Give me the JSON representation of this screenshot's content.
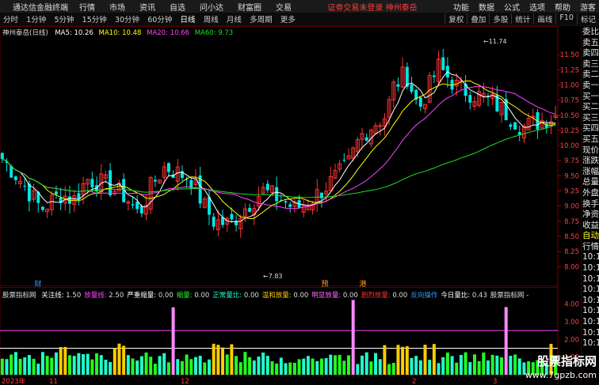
{
  "window": {
    "app_name": "通达信金融终端",
    "menus": [
      "行情",
      "市场",
      "资讯",
      "自选",
      "问小达",
      "财富圈",
      "交易"
    ],
    "notice": "证劵交易未登录",
    "stock_notice": "神州泰岳",
    "right_menu": [
      "功能",
      "数据",
      "公式",
      "选项",
      "帮助",
      "游客"
    ]
  },
  "toolbar": {
    "timeframes": [
      "分时",
      "1分钟",
      "5分钟",
      "15分钟",
      "30分钟",
      "60分钟",
      "日线",
      "周线",
      "月线",
      "多周期",
      "更多"
    ],
    "active_timeframe": "日线",
    "tools": [
      "复权",
      "叠加",
      "多股",
      "统计",
      "画线",
      "F10",
      "标记"
    ]
  },
  "main_chart": {
    "stock": "神州泰岳(日线)",
    "ma": [
      {
        "name": "MA5",
        "value": "10.26",
        "color": "#ffffff"
      },
      {
        "name": "MA10",
        "value": "10.48",
        "color": "#ffff00"
      },
      {
        "name": "MA20",
        "value": "10.66",
        "color": "#ff44ff"
      },
      {
        "name": "MA60",
        "value": "9.73",
        "color": "#22dd22"
      }
    ],
    "high_label": "11.74",
    "low_label": "7.83",
    "markers": [
      "财",
      "预",
      "港"
    ],
    "y_ticks": [
      "11.50",
      "11.25",
      "11.00",
      "10.75",
      "10.50",
      "10.25",
      "10.00",
      "9.75",
      "9.50",
      "9.25",
      "9.00",
      "8.75",
      "8.50",
      "8.25",
      "8.00"
    ]
  },
  "sub_chart": {
    "name": "股票指标网",
    "params": [
      {
        "label": "关注线",
        "value": "1.50",
        "color": "#ffffff"
      },
      {
        "label": "放量线",
        "value": "2.50",
        "color": "#ff44ff"
      },
      {
        "label": "严重缩量",
        "value": "0.00",
        "color": "#ffffff"
      },
      {
        "label": "缩量",
        "value": "0.00",
        "color": "#22ff22"
      },
      {
        "label": "正常量比",
        "value": "0.00",
        "color": "#22ffcc"
      },
      {
        "label": "温和放量",
        "value": "0.00",
        "color": "#ffcc00"
      },
      {
        "label": "明显放量",
        "value": "0.00",
        "color": "#ff66ff"
      },
      {
        "label": "剧烈放量",
        "value": "0.00",
        "color": "#ff3333"
      },
      {
        "label": "反向操作",
        "value": "",
        "color": "#3399ff"
      },
      {
        "label": "今日量比",
        "value": "0.43",
        "color": "#ffffff"
      }
    ],
    "tail": "股票指标网 -",
    "y_ticks": [
      "4.00",
      "3.00",
      "2.00",
      "1.00"
    ]
  },
  "x_axis": [
    "2023年",
    "11",
    "12",
    "2",
    "3"
  ],
  "right_panel": [
    "委比",
    "卖五",
    "卖四",
    "卖三",
    "卖二",
    "卖一",
    "买一",
    "买二",
    "买三",
    "买四",
    "买五",
    "现价",
    "涨跌",
    "涨幅",
    "总量",
    "外盘",
    "换手",
    "净资",
    "收益",
    "自动",
    "行情",
    "10:1",
    "10:1",
    "10:1",
    "10:1",
    "10:1",
    "10:1",
    "10:1",
    "10:1",
    "10:1"
  ],
  "watermark": {
    "name": "股票指标网",
    "url": "www.7gpzb.com"
  }
}
